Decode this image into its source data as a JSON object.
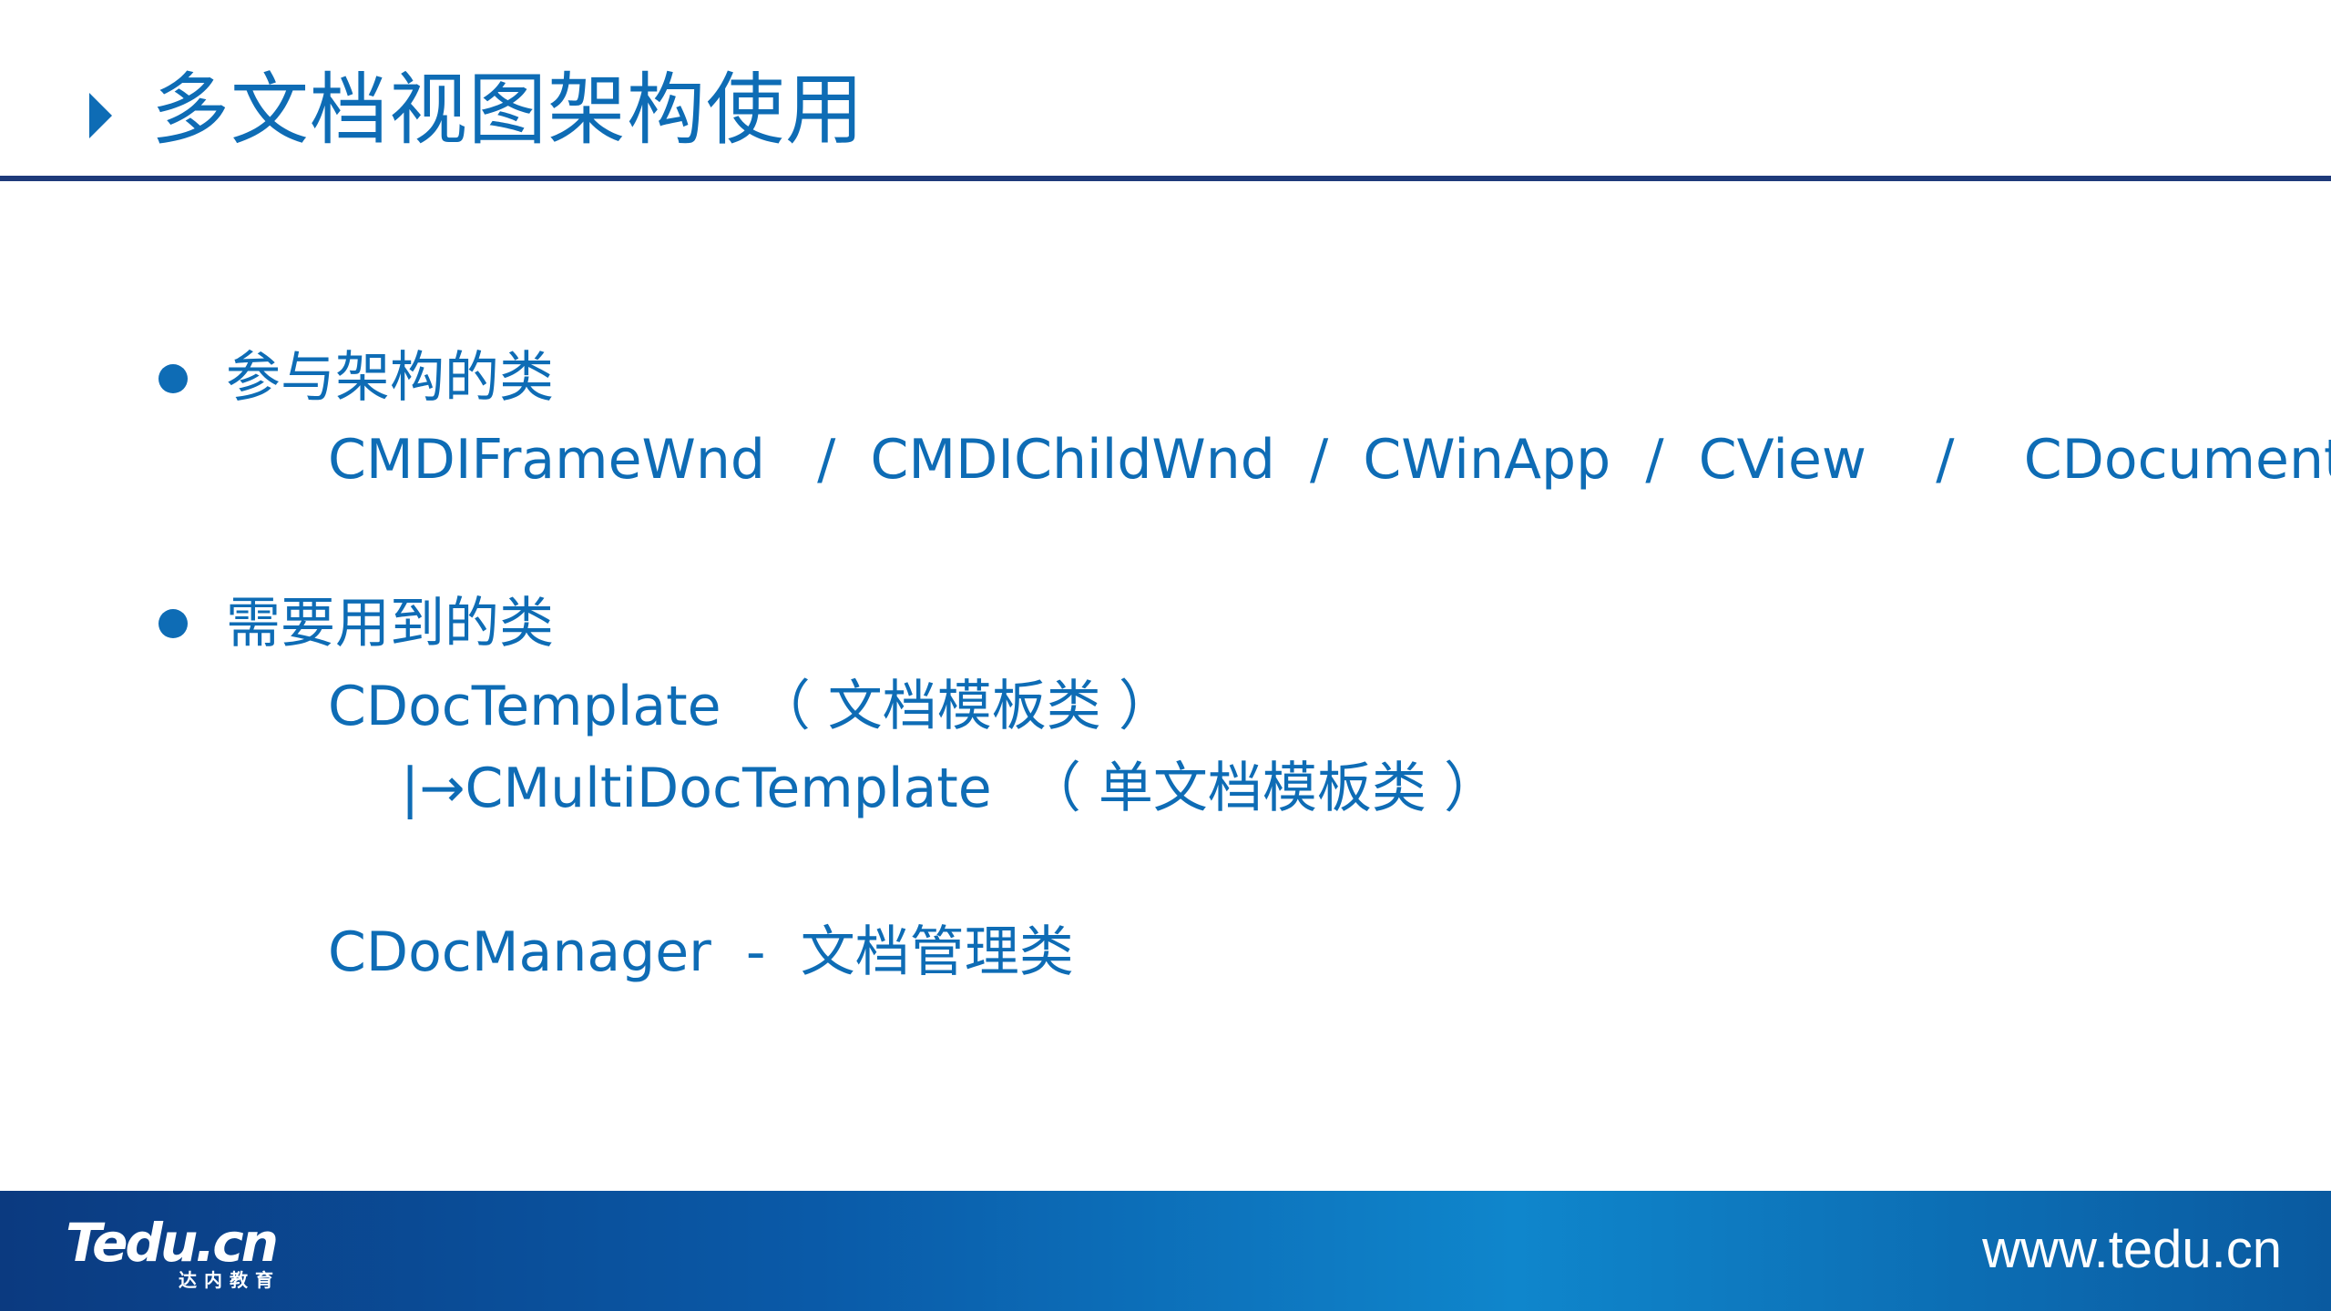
{
  "header": {
    "title": "多文档视图架构使用",
    "accent_color": "#0e6cb5",
    "rule_color": "#1e3a7a"
  },
  "content": {
    "section1": {
      "heading": "参与架构的类",
      "classes": "CMDIFrameWnd   /  CMDIChildWnd  /  CWinApp  /  CView    /    CDocument"
    },
    "section2": {
      "heading": "需要用到的类",
      "lines": [
        "CDocTemplate  （ 文档模板类 ）",
        "|→CMultiDocTemplate  （ 单文档模板类 ）",
        "CDocManager  -  文档管理类"
      ]
    }
  },
  "footer": {
    "logo": "Tedu.cn",
    "logo_subtitle": "达内教育",
    "url": "www.tedu.cn"
  }
}
